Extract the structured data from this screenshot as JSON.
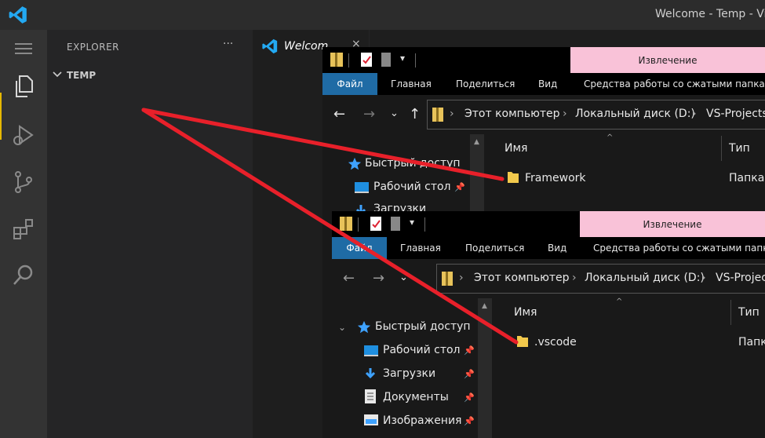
{
  "vscode": {
    "window_title": "Welcome - Temp - Vi",
    "explorer_title": "EXPLORER",
    "explorer_more": "···",
    "folder": "TEMP",
    "tab_label": "Welcom",
    "tab_close": "×"
  },
  "explorer_back": {
    "context_tab": "Извлечение",
    "ribbon_tabs": [
      "Файл",
      "Главная",
      "Поделиться",
      "Вид",
      "Средства работы со сжатыми папками"
    ],
    "breadcrumb": [
      "Этот компьютер",
      "Локальный диск (D:)",
      "VS-Projects"
    ],
    "nav_items": [
      {
        "label": "Быстрый доступ",
        "icon": "star-icon"
      },
      {
        "label": "Рабочий стол",
        "icon": "desktop-icon"
      },
      {
        "label": "Загрузки",
        "icon": "download-icon"
      }
    ],
    "col_name": "Имя",
    "col_type": "Тип",
    "files": [
      {
        "name": "Framework",
        "type": "Папка"
      }
    ]
  },
  "explorer_front": {
    "context_tab": "Извлечение",
    "ribbon_tabs": [
      "Файл",
      "Главная",
      "Поделиться",
      "Вид",
      "Средства работы со сжатыми папками"
    ],
    "breadcrumb": [
      "Этот компьютер",
      "Локальный диск (D:)",
      "VS-Projects"
    ],
    "nav_items": [
      {
        "label": "Быстрый доступ",
        "icon": "star-icon"
      },
      {
        "label": "Рабочий стол",
        "icon": "desktop-icon"
      },
      {
        "label": "Загрузки",
        "icon": "download-icon"
      },
      {
        "label": "Документы",
        "icon": "documents-icon"
      },
      {
        "label": "Изображения",
        "icon": "images-icon"
      }
    ],
    "col_name": "Имя",
    "col_type": "Тип",
    "files": [
      {
        "name": ".vscode",
        "type": "Папк"
      }
    ]
  },
  "colors": {
    "arrow": "#e8202a",
    "ribbon_active": "#1f6ba5",
    "context_tab_bg": "#f9c2d8",
    "vscode_accent": "#e6b800"
  }
}
